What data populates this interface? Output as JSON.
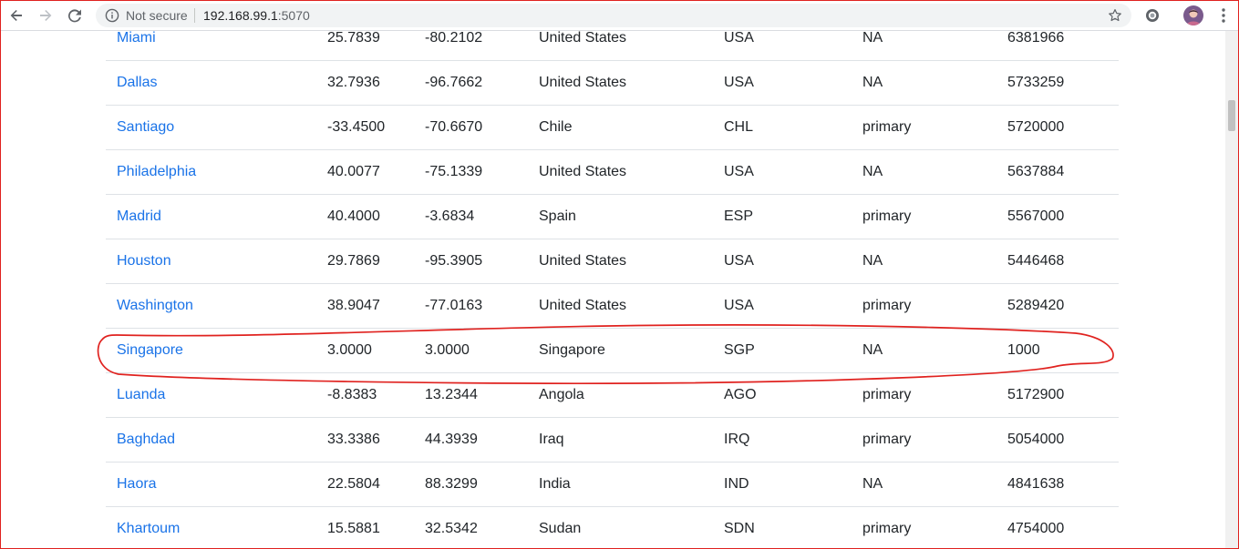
{
  "browser": {
    "security_label": "Not secure",
    "url_host": "192.168.99.1",
    "url_port": ":5070",
    "icons": {
      "back": "arrow-left-icon",
      "forward": "arrow-right-icon",
      "reload": "reload-icon",
      "info": "info-icon",
      "bookmark": "star-icon",
      "extension": "extension-icon",
      "menu": "kebab-menu-icon"
    }
  },
  "table": {
    "rows": [
      {
        "city": "Miami",
        "lat": "25.7839",
        "lng": "-80.2102",
        "country": "United States",
        "iso3": "USA",
        "capital": "NA",
        "population": "6381966"
      },
      {
        "city": "Dallas",
        "lat": "32.7936",
        "lng": "-96.7662",
        "country": "United States",
        "iso3": "USA",
        "capital": "NA",
        "population": "5733259"
      },
      {
        "city": "Santiago",
        "lat": "-33.4500",
        "lng": "-70.6670",
        "country": "Chile",
        "iso3": "CHL",
        "capital": "primary",
        "population": "5720000"
      },
      {
        "city": "Philadelphia",
        "lat": "40.0077",
        "lng": "-75.1339",
        "country": "United States",
        "iso3": "USA",
        "capital": "NA",
        "population": "5637884"
      },
      {
        "city": "Madrid",
        "lat": "40.4000",
        "lng": "-3.6834",
        "country": "Spain",
        "iso3": "ESP",
        "capital": "primary",
        "population": "5567000"
      },
      {
        "city": "Houston",
        "lat": "29.7869",
        "lng": "-95.3905",
        "country": "United States",
        "iso3": "USA",
        "capital": "NA",
        "population": "5446468"
      },
      {
        "city": "Washington",
        "lat": "38.9047",
        "lng": "-77.0163",
        "country": "United States",
        "iso3": "USA",
        "capital": "primary",
        "population": "5289420"
      },
      {
        "city": "Singapore",
        "lat": "3.0000",
        "lng": "3.0000",
        "country": "Singapore",
        "iso3": "SGP",
        "capital": "NA",
        "population": "1000"
      },
      {
        "city": "Luanda",
        "lat": "-8.8383",
        "lng": "13.2344",
        "country": "Angola",
        "iso3": "AGO",
        "capital": "primary",
        "population": "5172900"
      },
      {
        "city": "Baghdad",
        "lat": "33.3386",
        "lng": "44.3939",
        "country": "Iraq",
        "iso3": "IRQ",
        "capital": "primary",
        "population": "5054000"
      },
      {
        "city": "Haora",
        "lat": "22.5804",
        "lng": "88.3299",
        "country": "India",
        "iso3": "IND",
        "capital": "NA",
        "population": "4841638"
      },
      {
        "city": "Khartoum",
        "lat": "15.5881",
        "lng": "32.5342",
        "country": "Sudan",
        "iso3": "SDN",
        "capital": "primary",
        "population": "4754000"
      }
    ]
  },
  "colors": {
    "link": "#1a73e8",
    "annotation": "#e0221f",
    "row_border": "#dee2e6"
  }
}
